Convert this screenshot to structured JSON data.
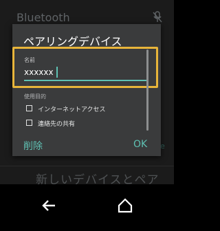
{
  "background": {
    "title": "Bluetooth",
    "bottom_text": "新しいデバイスとペア",
    "side_text": "e"
  },
  "dialog": {
    "title": "ペアリングデバイス",
    "name_label": "名前",
    "name_value": "xxxxxx",
    "usage_label": "使用目的",
    "options": [
      {
        "label": "インターネットアクセス",
        "checked": false
      },
      {
        "label": "連絡先の共有",
        "checked": false
      }
    ],
    "delete_label": "削除",
    "ok_label": "OK"
  },
  "colors": {
    "accent": "#5fc2b4",
    "focus_outline": "#e8b53a",
    "dialog_bg": "#3a3b3c"
  },
  "icons": {
    "status": "mute-icon",
    "back": "back-arrow-icon",
    "home": "home-icon"
  }
}
